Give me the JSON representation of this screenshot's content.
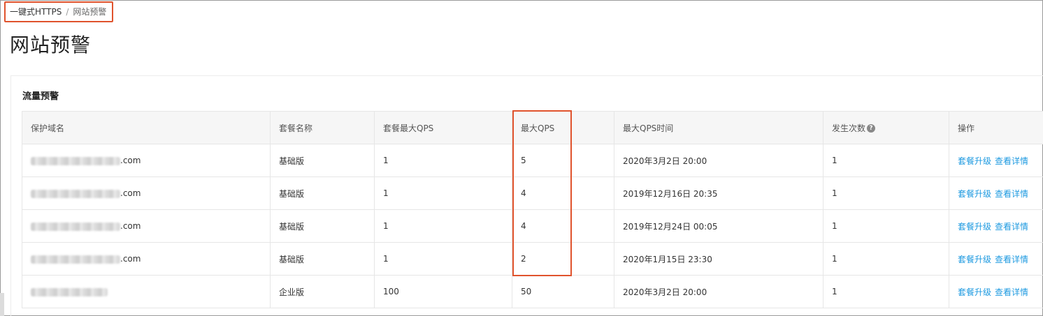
{
  "breadcrumb": {
    "root": "一键式HTTPS",
    "separator": "/",
    "current": "网站预警"
  },
  "page": {
    "title": "网站预警"
  },
  "panel": {
    "title": "流量预警"
  },
  "table": {
    "headers": [
      "保护域名",
      "套餐名称",
      "套餐最大QPS",
      "最大QPS",
      "最大QPS时间",
      "发生次数",
      "操作"
    ],
    "rows": [
      {
        "domain_suffix": ".com",
        "plan": "基础版",
        "plan_max_qps": "1",
        "max_qps": "5",
        "max_qps_time": "2020年3月2日 20:00",
        "count": "1"
      },
      {
        "domain_suffix": ".com",
        "plan": "基础版",
        "plan_max_qps": "1",
        "max_qps": "4",
        "max_qps_time": "2019年12月16日 20:35",
        "count": "1"
      },
      {
        "domain_suffix": ".com",
        "plan": "基础版",
        "plan_max_qps": "1",
        "max_qps": "4",
        "max_qps_time": "2019年12月24日 00:05",
        "count": "1"
      },
      {
        "domain_suffix": ".com",
        "plan": "基础版",
        "plan_max_qps": "1",
        "max_qps": "2",
        "max_qps_time": "2020年1月15日 23:30",
        "count": "1"
      },
      {
        "domain_suffix": "",
        "plan": "企业版",
        "plan_max_qps": "100",
        "max_qps": "50",
        "max_qps_time": "2020年3月2日 20:00",
        "count": "1"
      }
    ],
    "actions": {
      "upgrade": "套餐升级",
      "details": "查看详情"
    }
  },
  "colors": {
    "highlight": "#e0532d",
    "link": "#1e9ae0"
  }
}
